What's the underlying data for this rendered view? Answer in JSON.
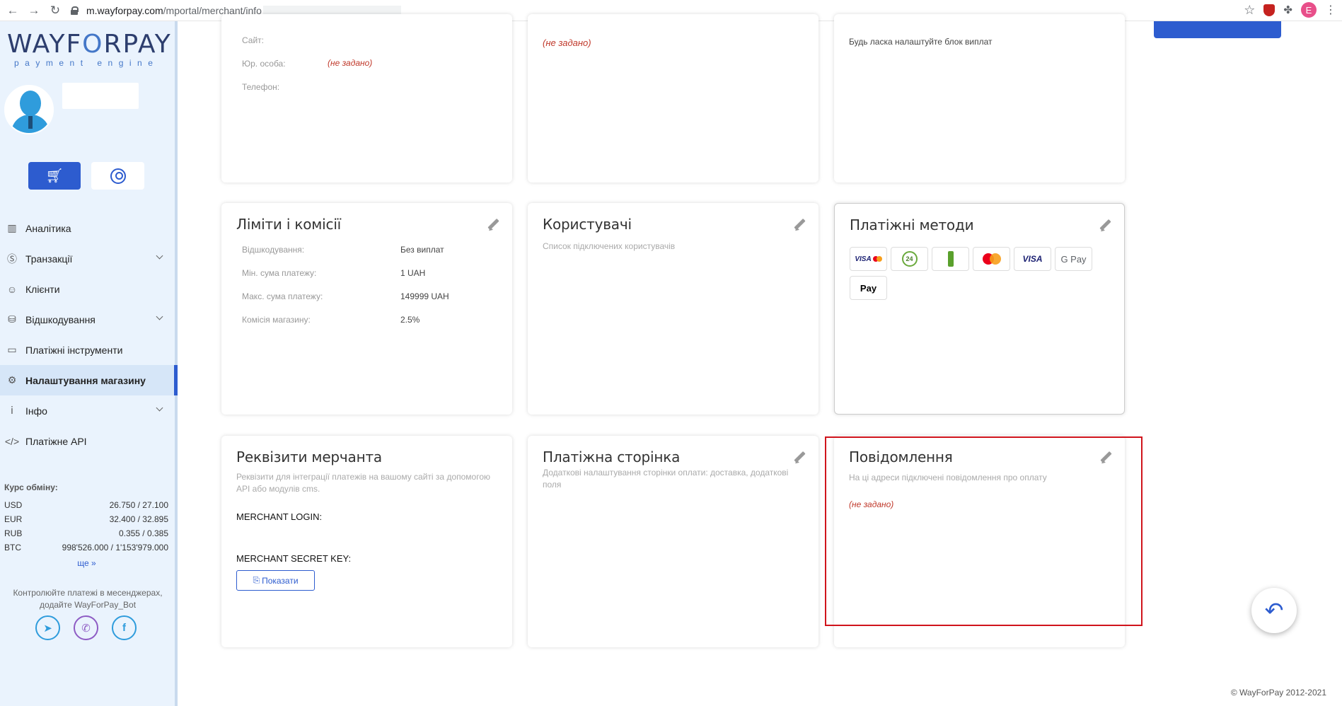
{
  "browser": {
    "url_host": "m.wayforpay.com",
    "url_path": "/mportal/merchant/info",
    "profile_initial": "E"
  },
  "sidebar": {
    "logo_main": "WAYFORPAY",
    "logo_sub": "payment engine",
    "menu": [
      {
        "label": "Аналітика",
        "icon": "analytics-icon"
      },
      {
        "label": "Транзакції",
        "icon": "dollar-icon"
      },
      {
        "label": "Клієнти",
        "icon": "clients-icon"
      },
      {
        "label": "Відшкодування",
        "icon": "refund-icon"
      },
      {
        "label": "Платіжні інструменти",
        "icon": "card-icon"
      },
      {
        "label": "Налаштування магазину",
        "icon": "gear-icon"
      },
      {
        "label": "Інфо",
        "icon": "info-icon"
      },
      {
        "label": "Платіжне API",
        "icon": "code-icon"
      }
    ],
    "rates_title": "Курс обміну:",
    "rates": [
      {
        "currency": "USD",
        "value": "26.750 / 27.100"
      },
      {
        "currency": "EUR",
        "value": "32.400 / 32.895"
      },
      {
        "currency": "RUB",
        "value": "0.355 / 0.385"
      },
      {
        "currency": "BTC",
        "value": "998'526.000 / 1'153'979.000"
      }
    ],
    "more": "ще »",
    "promo": "Контролюйте платежі в месенджерах, додайте WayForPay_Bot"
  },
  "cards": {
    "info": {
      "site_label": "Сайт:",
      "legal_label": "Юр. особа:",
      "legal_value": "(не задано)",
      "phone_label": "Телефон:"
    },
    "info2": {
      "not_set": "(не задано)"
    },
    "payouts": {
      "text": "Будь ласка налаштуйте блок виплат"
    },
    "limits": {
      "title": "Ліміти і комісії",
      "rows": [
        {
          "label": "Відшкодування:",
          "value": "Без виплат"
        },
        {
          "label": "Мін. сума платежу:",
          "value": "1 UAH"
        },
        {
          "label": "Макс. сума платежу:",
          "value": "149999 UAH"
        },
        {
          "label": "Комісія магазину:",
          "value": "2.5%"
        }
      ]
    },
    "users": {
      "title": "Користувачі",
      "sub": "Список підключених користувачів"
    },
    "methods": {
      "title": "Платіжні методи",
      "items": [
        "VISA",
        "24",
        "",
        "",
        "VISA",
        "G Pay",
        " Pay"
      ]
    },
    "requisites": {
      "title": "Реквізити мерчанта",
      "sub": "Реквізити для інтеграції платежів на вашому сайті за допомогою API або модулів cms.",
      "login_label": "MERCHANT LOGIN:",
      "secret_label": "MERCHANT SECRET KEY:",
      "show_button": "Показати"
    },
    "paypage": {
      "title": "Платіжна сторінка",
      "sub": "Додаткові налаштування сторінки оплати: доставка, додаткові поля"
    },
    "notifications": {
      "title": "Повідомлення",
      "sub": "На ці адреси підключені повідомлення про оплату",
      "not_set": "(не задано)"
    }
  },
  "footer": "© WayForPay 2012-2021"
}
